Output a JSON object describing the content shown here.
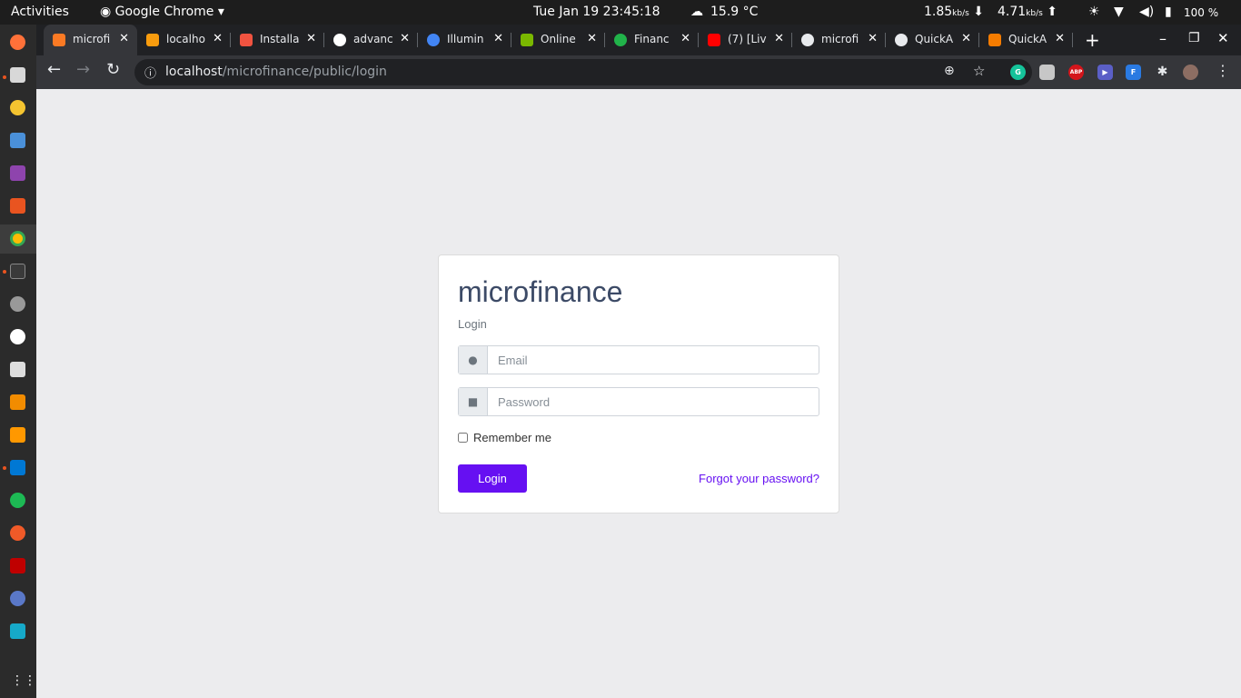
{
  "system": {
    "activities": "Activities",
    "app_menu": "Google Chrome",
    "clock": "Tue Jan 19  23:45:18",
    "weather": "15.9 °C",
    "net_down": "1.85",
    "net_down_unit": "kb/s",
    "net_up": "4.71",
    "net_up_unit": "kb/s",
    "battery": "100 %"
  },
  "tabs": [
    {
      "label": "microfi",
      "icon": "xampp-icon",
      "color": "#fb7a24"
    },
    {
      "label": "localho",
      "icon": "phpmyadmin-icon",
      "color": "#f89c0e"
    },
    {
      "label": "Installa",
      "icon": "laravel-icon",
      "color": "#f05340"
    },
    {
      "label": "advanc",
      "icon": "github-icon",
      "color": "#ffffff"
    },
    {
      "label": "Illumin",
      "icon": "google-icon",
      "color": "#4285f4"
    },
    {
      "label": "Online",
      "icon": "t-icon",
      "color": "#7ab800"
    },
    {
      "label": "Financ",
      "icon": "check-icon",
      "color": "#21b34a"
    },
    {
      "label": "(7) [Liv",
      "icon": "youtube-icon",
      "color": "#ff0000"
    },
    {
      "label": "microfi",
      "icon": "globe-icon",
      "color": "#e8eaed"
    },
    {
      "label": "QuickA",
      "icon": "globe-icon",
      "color": "#e8eaed"
    },
    {
      "label": "QuickA",
      "icon": "book-icon",
      "color": "#f57c00"
    }
  ],
  "address": {
    "host": "localhost",
    "path": "/microfinance/public/login"
  },
  "login": {
    "brand": "microfinance",
    "subtitle": "Login",
    "email_placeholder": "Email",
    "password_placeholder": "Password",
    "remember_label": "Remember me",
    "submit_label": "Login",
    "forgot_label": "Forgot your password?"
  },
  "extensions": [
    "grammarly-icon",
    "extension-icon",
    "adblock-icon",
    "meet-icon",
    "translate-icon",
    "puzzle-icon",
    "profile-avatar"
  ],
  "colors": {
    "accent": "#6610f2",
    "title": "#3c4a66"
  }
}
